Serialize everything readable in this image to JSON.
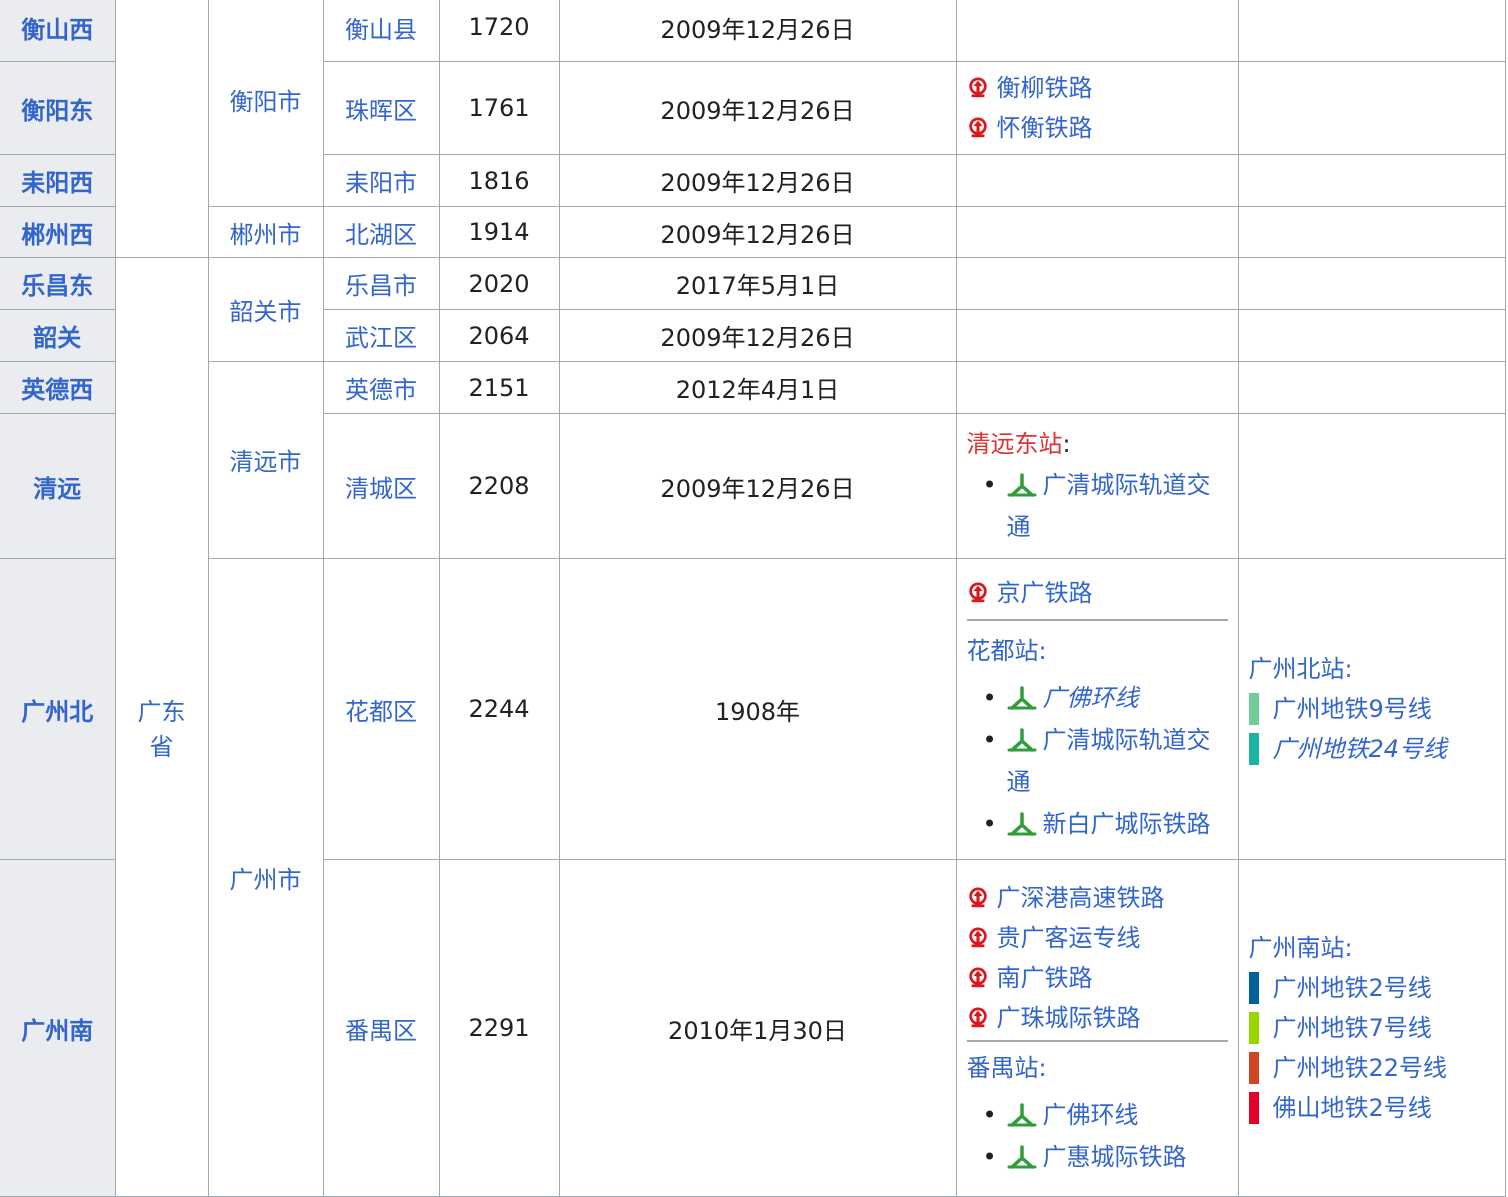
{
  "rows": [
    {
      "station": "衡山西",
      "county": "衡山县",
      "km": "1720",
      "date": "2009年12月26日"
    },
    {
      "station": "衡阳东",
      "county": "珠晖区",
      "km": "1761",
      "date": "2009年12月26日"
    },
    {
      "station": "耒阳西",
      "county": "耒阳市",
      "km": "1816",
      "date": "2009年12月26日"
    },
    {
      "station": "郴州西",
      "county": "北湖区",
      "km": "1914",
      "date": "2009年12月26日"
    },
    {
      "station": "乐昌东",
      "county": "乐昌市",
      "km": "2020",
      "date": "2017年5月1日"
    },
    {
      "station": "韶关",
      "county": "武江区",
      "km": "2064",
      "date": "2009年12月26日"
    },
    {
      "station": "英德西",
      "county": "英德市",
      "km": "2151",
      "date": "2012年4月1日"
    },
    {
      "station": "清远",
      "county": "清城区",
      "km": "2208",
      "date": "2009年12月26日"
    },
    {
      "station": "广州北",
      "county": "花都区",
      "km": "2244",
      "date": "1908年"
    },
    {
      "station": "广州南",
      "county": "番禺区",
      "km": "2291",
      "date": "2010年1月30日"
    }
  ],
  "cities": {
    "hengyang": "衡阳市",
    "chenzhou": "郴州市",
    "shaoguan": "韶关市",
    "qingyuan": "清远市",
    "guangzhou": "广州市"
  },
  "province": {
    "line1": "广东",
    "line2": "省"
  },
  "connections": {
    "hengyangdong": [
      "衡柳铁路",
      "怀衡铁路"
    ],
    "qingyuan": {
      "heading": "清远东站",
      "colon": ":",
      "item1_line1": "广清城际轨道交",
      "item1_line2": "通"
    },
    "guangzhoubei": {
      "rail": "京广铁路",
      "heading": "花都站:",
      "item1": "广佛环线",
      "item2_line1": "广清城际轨道交",
      "item2_line2": "通",
      "item3": "新白广城际铁路"
    },
    "guangzhounan": {
      "rails": [
        "广深港高速铁路",
        "贵广客运专线",
        "南广铁路",
        "广珠城际铁路"
      ],
      "heading": "番禺站:",
      "item1": "广佛环线",
      "item2": "广惠城际铁路"
    }
  },
  "metro": {
    "guangzhoubei": {
      "heading": "广州北站:",
      "lines": [
        {
          "name": "广州地铁9号线",
          "color": "#71cc98",
          "italic": false
        },
        {
          "name": "广州地铁24号线",
          "color": "#1db3a3",
          "italic": true
        }
      ]
    },
    "guangzhounan": {
      "heading": "广州南站:",
      "lines": [
        {
          "name": "广州地铁2号线",
          "color": "#00629b",
          "italic": false
        },
        {
          "name": "广州地铁7号线",
          "color": "#97d700",
          "italic": false
        },
        {
          "name": "广州地铁22号线",
          "color": "#cf4520",
          "italic": false
        },
        {
          "name": "佛山地铁2号线",
          "color": "#e4002b",
          "italic": false
        }
      ]
    }
  },
  "icon_colors": {
    "china_railway": "#d7191c",
    "gz_intercity": "#2e9e3b"
  }
}
